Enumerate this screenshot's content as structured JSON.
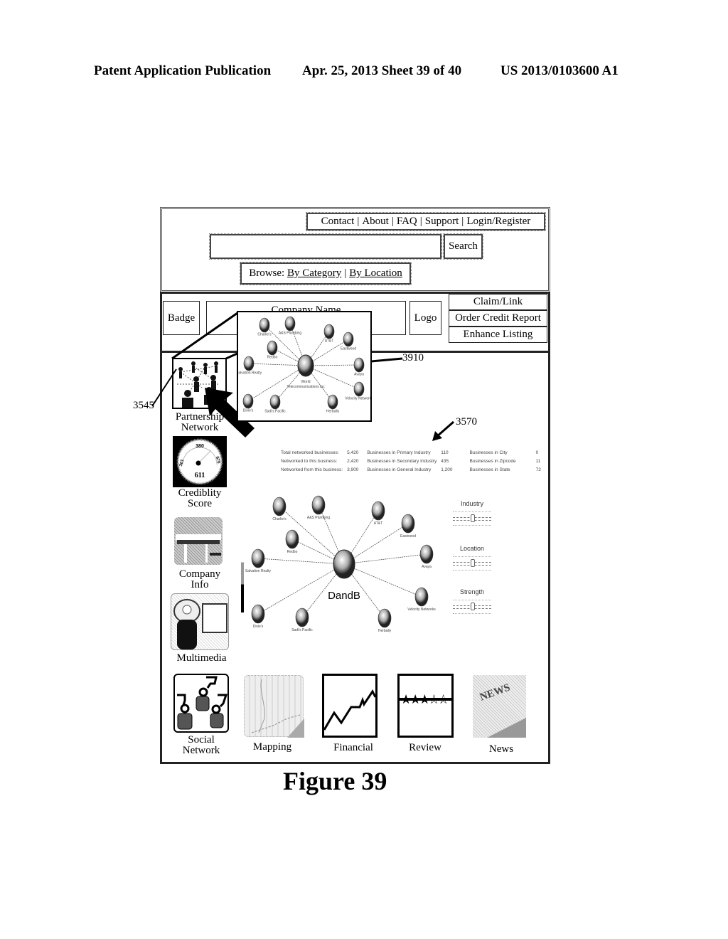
{
  "header": {
    "publication": "Patent Application Publication",
    "date_sheet": "Apr. 25, 2013  Sheet 39 of 40",
    "patent_number": "US 2013/0103600 A1"
  },
  "topnav": {
    "links": [
      "Contact",
      "About",
      "FAQ",
      "Support",
      "Login/Register"
    ],
    "separator": "|"
  },
  "search": {
    "input_value": "",
    "button_label": "Search"
  },
  "browse": {
    "prefix": "Browse:",
    "links": [
      "By Category",
      "By Location"
    ],
    "separator": "|"
  },
  "company_bar": {
    "badge": "Badge",
    "company_name": "Company Name",
    "logo": "Logo",
    "actions": [
      "Claim/Link",
      "Order Credit Report",
      "Enhance Listing"
    ]
  },
  "sidebar": {
    "items": [
      {
        "label_line1": "Partnership",
        "label_line2": "Network",
        "icon": "partnership-network-icon"
      },
      {
        "label_line1": "Crediblity",
        "label_line2": "Score",
        "icon": "gauge-icon"
      },
      {
        "label_line1": "Company",
        "label_line2": "Info",
        "icon": "building-icon"
      },
      {
        "label_line1": "Multimedia",
        "label_line2": "",
        "icon": "camera-icon"
      }
    ],
    "gauge": {
      "top": "380",
      "left": "301",
      "right": "670",
      "value": "611"
    }
  },
  "popup": {
    "center_label_line1": "World",
    "center_label_line2": "Telecommunications Inc",
    "nodes": [
      "Charlie's",
      "A&S Plumbing",
      "AT&T",
      "Eastwood",
      "Avaya",
      "Velocity Networks",
      "Herbally",
      "Sadi's Pacific",
      "Dixie's",
      "Salvation Realty",
      "Redbo"
    ]
  },
  "stats": {
    "rows": [
      [
        "Total networked businesses:",
        "5,420",
        "Businesses in Primary Industry",
        "110",
        "Businesses in City",
        "0"
      ],
      [
        "Networked to this business:",
        "2,420",
        "Businesses in Secondary Industry",
        "435",
        "Businesses in Zipcode",
        "11"
      ],
      [
        "Networked from this business:",
        "3,900",
        "Businesses in General Industry",
        "1,200",
        "Businesses in State",
        "72"
      ]
    ]
  },
  "network": {
    "center_label": "DandB",
    "nodes": [
      "Charlie's",
      "A&S Plumbing",
      "AT&T",
      "Eastwood",
      "Redbo",
      "Avaya",
      "Salvation Realty",
      "Velocity Networks",
      "Dixie's",
      "Sadi's Pacific",
      "Herbally"
    ]
  },
  "filters": [
    {
      "label": "Industry",
      "value": 0.5
    },
    {
      "label": "Location",
      "value": 0.5
    },
    {
      "label": "Strength",
      "value": 0.5
    }
  ],
  "bottom_tiles": [
    {
      "label_line1": "Social",
      "label_line2": "Network"
    },
    {
      "label_line1": "Mapping",
      "label_line2": ""
    },
    {
      "label_line1": "Financial",
      "label_line2": ""
    },
    {
      "label_line1": "Review",
      "label_line2": ""
    },
    {
      "label_line1": "News",
      "label_line2": ""
    }
  ],
  "review": {
    "stars_filled": 3,
    "stars_total": 5
  },
  "news_icon_text": "NEWS",
  "refs": {
    "r3545": "3545",
    "r3570": "3570",
    "r3910": "3910"
  },
  "caption": "Figure 39"
}
